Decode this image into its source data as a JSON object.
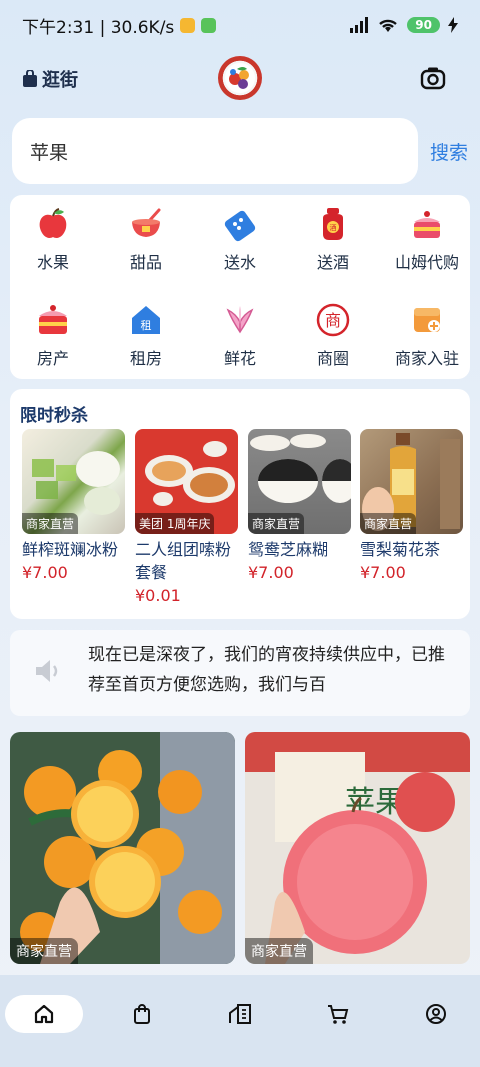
{
  "status_bar": {
    "time_and_speed": "下午2:31 | 30.6K/s",
    "battery": "90"
  },
  "header": {
    "guang_label": "逛街",
    "logo_icon": "fruit-logo-icon",
    "camera_icon": "camera-icon"
  },
  "search": {
    "value": "苹果",
    "button_label": "搜索"
  },
  "categories": [
    {
      "label": "水果",
      "icon": "apple-icon"
    },
    {
      "label": "甜品",
      "icon": "dessert-bowl-icon"
    },
    {
      "label": "送水",
      "icon": "water-icon"
    },
    {
      "label": "送酒",
      "icon": "wine-jar-icon"
    },
    {
      "label": "山姆代购",
      "icon": "cake-icon"
    },
    {
      "label": "房产",
      "icon": "cake-layer-icon"
    },
    {
      "label": "租房",
      "icon": "rent-house-icon"
    },
    {
      "label": "鲜花",
      "icon": "lily-flower-icon"
    },
    {
      "label": "商圈",
      "icon": "shang-circle-icon"
    },
    {
      "label": "商家入驻",
      "icon": "shop-join-icon"
    }
  ],
  "flash_sale": {
    "title": "限时秒杀",
    "products": [
      {
        "name": "鲜榨斑斓冰粉",
        "price": "¥7.00",
        "tag": "商家直营"
      },
      {
        "name": "二人组团嗦粉套餐",
        "price": "¥0.01",
        "tag": "美团 1周年庆"
      },
      {
        "name": "鸳鸯芝麻糊",
        "price": "¥7.00",
        "tag": "商家直营"
      },
      {
        "name": "雪梨菊花茶",
        "price": "¥7.00",
        "tag": "商家直营"
      }
    ]
  },
  "notice": {
    "text": "现在已是深夜了，我们的宵夜持续供应中，已推荐至首页方便您选购，我们与百"
  },
  "feed": [
    {
      "tag": "商家直营",
      "subject": "oranges"
    },
    {
      "tag": "商家直营",
      "subject": "apple"
    }
  ],
  "bottom_nav": [
    {
      "name": "home",
      "icon": "home-icon",
      "active": true
    },
    {
      "name": "shopping-bag",
      "icon": "bag-icon",
      "active": false
    },
    {
      "name": "buildings",
      "icon": "buildings-icon",
      "active": false
    },
    {
      "name": "cart",
      "icon": "cart-icon",
      "active": false
    },
    {
      "name": "profile",
      "icon": "user-circle-icon",
      "active": false
    }
  ],
  "colors": {
    "accent": "#2f7ee0",
    "price": "#d2232a",
    "title": "#1d3a6b"
  }
}
